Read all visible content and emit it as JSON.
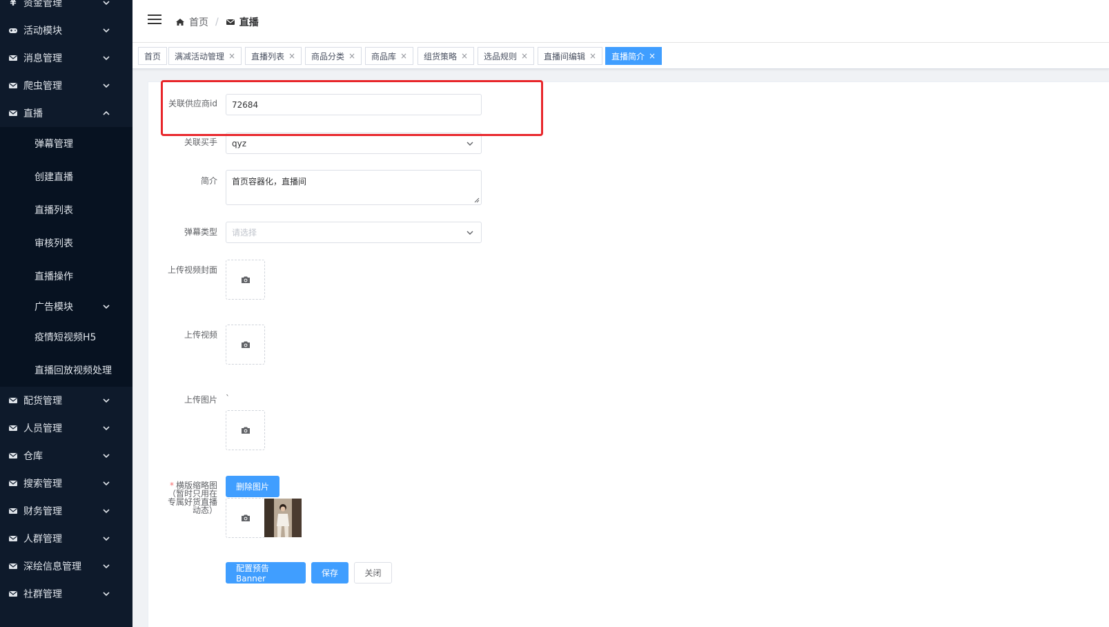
{
  "sidebar": {
    "top_items": [
      {
        "label": "资金管理",
        "icon": "yen-icon"
      },
      {
        "label": "活动模块",
        "icon": "gamepad-icon"
      },
      {
        "label": "消息管理",
        "icon": "mail-icon"
      },
      {
        "label": "爬虫管理",
        "icon": "mail-icon"
      },
      {
        "label": "直播",
        "icon": "mail-icon"
      }
    ],
    "sub_items": [
      {
        "label": "弹幕管理"
      },
      {
        "label": "创建直播"
      },
      {
        "label": "直播列表"
      },
      {
        "label": "审核列表"
      },
      {
        "label": "直播操作"
      },
      {
        "label": "广告模块"
      },
      {
        "label": "疫情短视频H5"
      },
      {
        "label": "直播回放视频处理"
      }
    ],
    "bottom_items": [
      {
        "label": "配货管理"
      },
      {
        "label": "人员管理"
      },
      {
        "label": "仓库"
      },
      {
        "label": "搜索管理"
      },
      {
        "label": "财务管理"
      },
      {
        "label": "人群管理"
      },
      {
        "label": "深绘信息管理"
      },
      {
        "label": "社群管理"
      }
    ]
  },
  "header": {
    "breadcrumb_home": "首页",
    "breadcrumb_sep": "/",
    "breadcrumb_current": "直播"
  },
  "tabs": [
    {
      "label": "首页",
      "closable": false
    },
    {
      "label": "满减活动管理",
      "closable": true
    },
    {
      "label": "直播列表",
      "closable": true
    },
    {
      "label": "商品分类",
      "closable": true
    },
    {
      "label": "商品库",
      "closable": true
    },
    {
      "label": "组货策略",
      "closable": true
    },
    {
      "label": "选品规则",
      "closable": true
    },
    {
      "label": "直播间编辑",
      "closable": true
    },
    {
      "label": "直播简介",
      "closable": true,
      "active": true
    }
  ],
  "tab_close_glyph": "×",
  "form": {
    "supplier_id_label": "关联供应商id",
    "supplier_id_value": "72684",
    "buyer_label": "关联买手",
    "buyer_value": "qyz",
    "intro_label": "简介",
    "intro_value": "首页容器化，直播间",
    "barrage_type_label": "弹幕类型",
    "barrage_type_placeholder": "请选择",
    "cover_label": "上传视频封面",
    "video_label": "上传视频",
    "image_label": "上传图片",
    "image_tick": "`",
    "thumb_label_required": "*",
    "thumb_label": "横版缩略图（暂时只用在专属好货直播动态）",
    "delete_image_button": "删除图片",
    "banner_button": "配置预告Banner",
    "save_button": "保存",
    "close_button": "关闭"
  },
  "colors": {
    "sidebar_bg": "#0e1a2b",
    "primary": "#409eff",
    "highlight": "#e8252a"
  }
}
